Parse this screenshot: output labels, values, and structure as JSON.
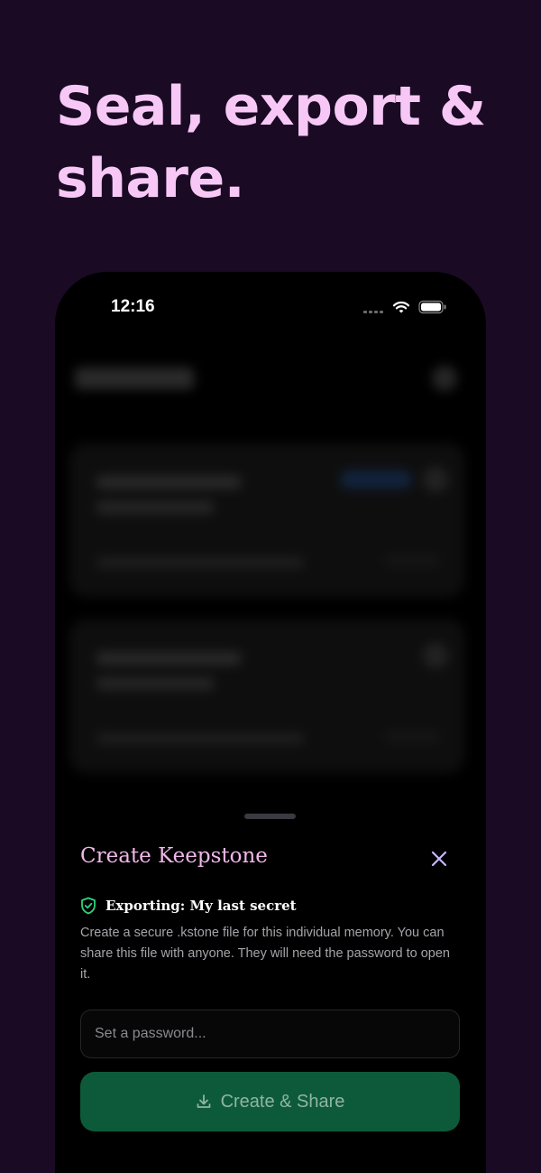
{
  "headline": "Seal, export & share.",
  "status_bar": {
    "time": "12:16",
    "icons": [
      "cellular-icon",
      "wifi-icon",
      "battery-icon"
    ]
  },
  "sheet": {
    "title": "Create Keepstone",
    "close_icon": "close-icon",
    "export_icon": "shield-check-icon",
    "export_label": "Exporting: My last secret",
    "description": "Create a secure .kstone file for this individual memory. You can share this file with anyone. They will need the password to open it.",
    "password_placeholder": "Set a password...",
    "password_value": "",
    "create_button": {
      "icon": "download-icon",
      "label": "Create & Share"
    }
  },
  "colors": {
    "background": "#1a0a24",
    "headline": "#f7c8f6",
    "sheet_title": "#f0b8e8",
    "shield": "#2ed47a",
    "button_bg": "#0d5a3a",
    "button_text": "#8fb5a2",
    "close": "#c8b8ff"
  }
}
